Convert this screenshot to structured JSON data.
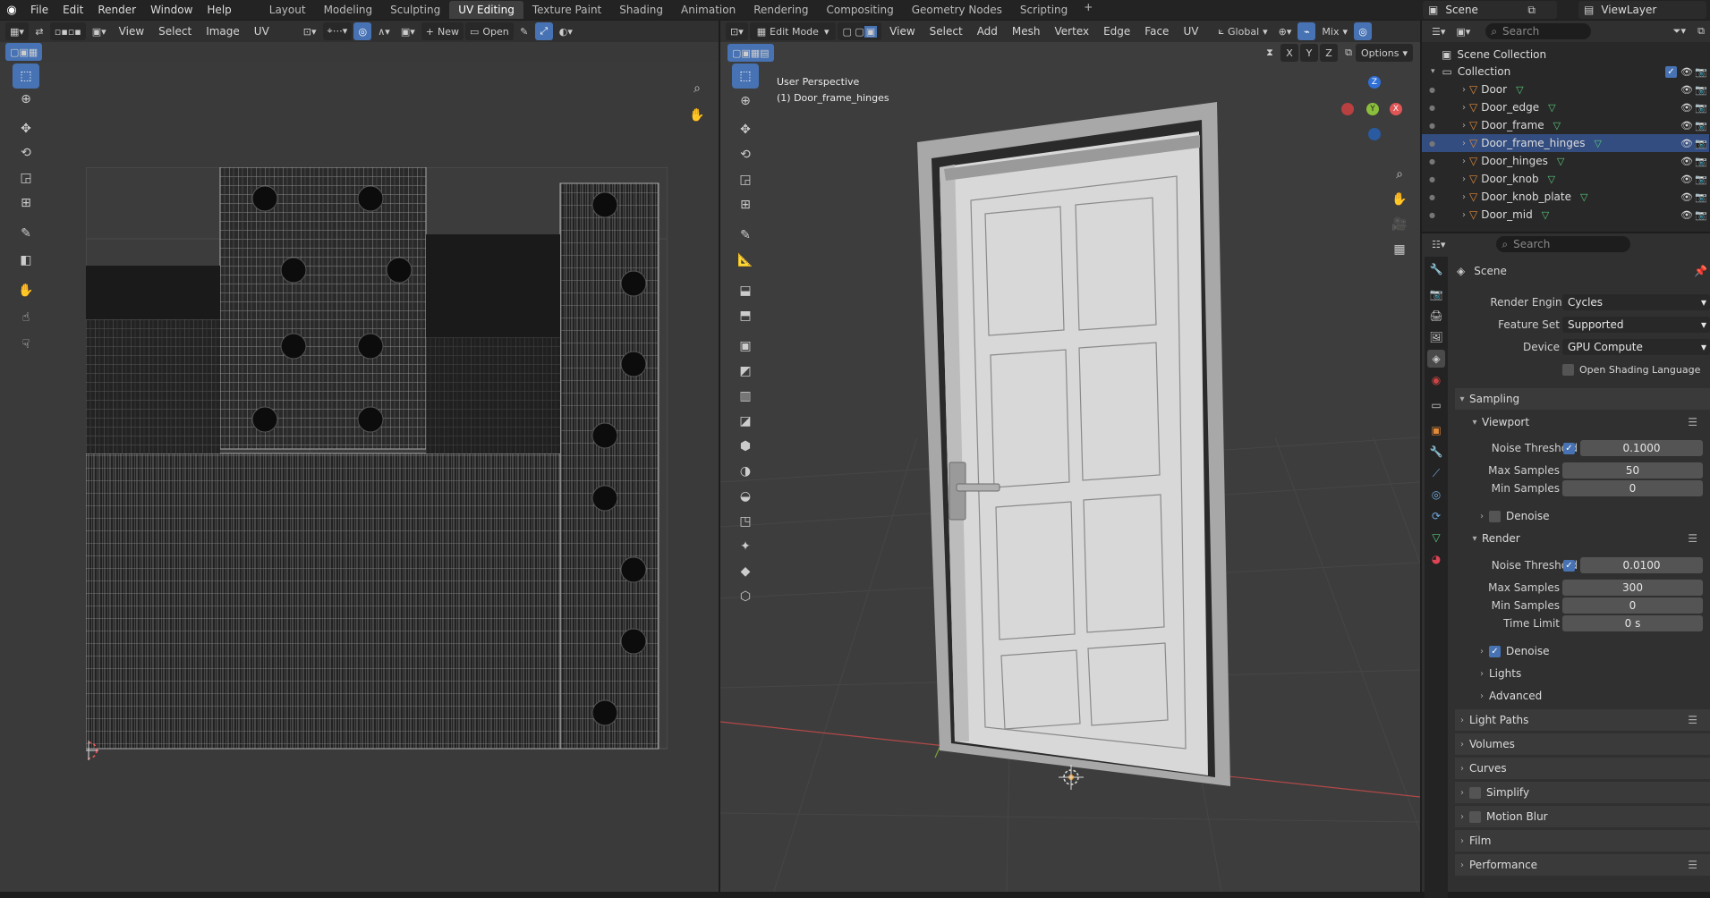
{
  "topbar": {
    "menus": [
      "File",
      "Edit",
      "Render",
      "Window",
      "Help"
    ],
    "workspaces": [
      "Layout",
      "Modeling",
      "Sculpting",
      "UV Editing",
      "Texture Paint",
      "Shading",
      "Animation",
      "Rendering",
      "Compositing",
      "Geometry Nodes",
      "Scripting"
    ],
    "active_workspace": "UV Editing",
    "scene": "Scene",
    "view_layer": "ViewLayer"
  },
  "uv_editor": {
    "menus": [
      "View",
      "Select",
      "Image",
      "UV"
    ],
    "new_label": "New",
    "open_label": "Open"
  },
  "viewport": {
    "mode": "Edit Mode",
    "menus": [
      "View",
      "Select",
      "Add",
      "Mesh",
      "Vertex",
      "Edge",
      "Face",
      "UV"
    ],
    "transform_orientation": "Global",
    "shading": "Mix",
    "axes": [
      "X",
      "Y",
      "Z"
    ],
    "options_label": "Options",
    "perspective_label": "User Perspective",
    "object_label": "(1) Door_frame_hinges"
  },
  "outliner": {
    "search_placeholder": "Search",
    "scene_collection": "Scene Collection",
    "collection": "Collection",
    "objects": [
      "Door",
      "Door_edge",
      "Door_frame",
      "Door_frame_hinges",
      "Door_hinges",
      "Door_knob",
      "Door_knob_plate",
      "Door_mid"
    ],
    "selected": "Door_frame_hinges"
  },
  "properties": {
    "search_placeholder": "Search",
    "context": "Scene",
    "render_engine_label": "Render Engine",
    "render_engine": "Cycles",
    "feature_set_label": "Feature Set",
    "feature_set": "Supported",
    "device_label": "Device",
    "device": "GPU Compute",
    "osl_label": "Open Shading Language",
    "sampling": "Sampling",
    "viewport": "Viewport",
    "render": "Render",
    "noise_threshold_label": "Noise Threshold",
    "max_samples_label": "Max Samples",
    "min_samples_label": "Min Samples",
    "time_limit_label": "Time Limit",
    "viewport_noise_threshold": "0.1000",
    "viewport_max_samples": "50",
    "viewport_min_samples": "0",
    "render_noise_threshold": "0.0100",
    "render_max_samples": "300",
    "render_min_samples": "0",
    "render_time_limit": "0 s",
    "denoise": "Denoise",
    "lights": "Lights",
    "advanced": "Advanced",
    "panels": [
      "Light Paths",
      "Volumes",
      "Curves",
      "Simplify",
      "Motion Blur",
      "Film",
      "Performance"
    ]
  },
  "colors": {
    "accent": "#4772b3",
    "selection": "#334d80",
    "mesh_icon": "#58c77a",
    "object_icon": "#e08a3a"
  }
}
